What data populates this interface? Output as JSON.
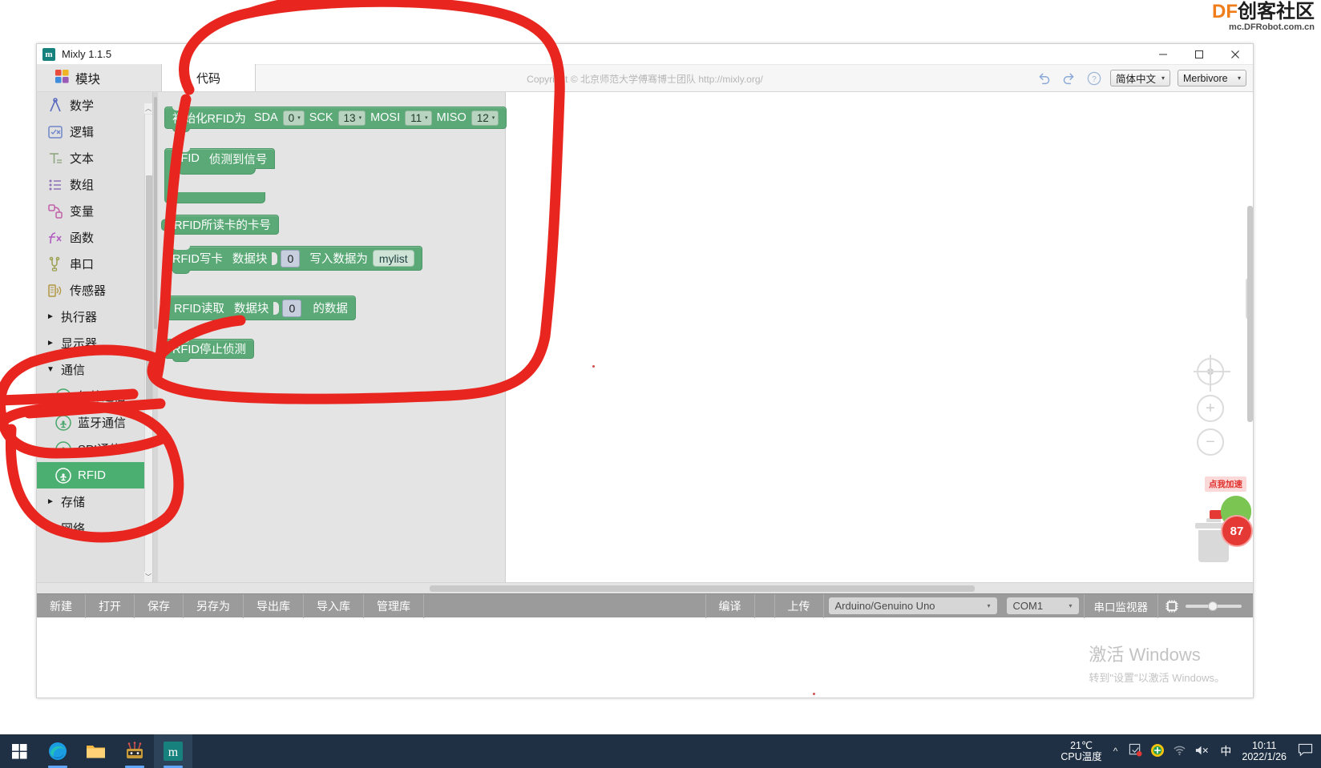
{
  "watermark": {
    "brand": "DF",
    "brand_cn": "创客社区",
    "url": "mc.DFRobot.com.cn"
  },
  "window": {
    "title": "Mixly 1.1.5",
    "app_icon": "m",
    "minimize": "—",
    "maximize": "☐",
    "close": "✕"
  },
  "topstrip": {
    "modules_label": "模块",
    "modules_icon": "blocks-icon",
    "tabs": [
      {
        "label": "代码"
      }
    ],
    "copyright": "Copyright © 北京师范大学傅骞博士团队 http://mixly.org/",
    "undo_icon": "undo-icon",
    "redo_icon": "redo-icon",
    "help_icon": "help-icon",
    "language": "简体中文",
    "theme": "Merbivore",
    "caret": "▾"
  },
  "sidebar": {
    "items": [
      {
        "label": "数学",
        "icon": "math-icon",
        "type": "leaf",
        "selected": false
      },
      {
        "label": "逻辑",
        "icon": "logic-icon",
        "type": "leaf",
        "selected": false
      },
      {
        "label": "文本",
        "icon": "text-icon",
        "type": "leaf",
        "selected": false
      },
      {
        "label": "数组",
        "icon": "array-icon",
        "type": "leaf",
        "selected": false
      },
      {
        "label": "变量",
        "icon": "variable-icon",
        "type": "leaf",
        "selected": false
      },
      {
        "label": "函数",
        "icon": "function-icon",
        "type": "leaf",
        "selected": false
      },
      {
        "label": "串口",
        "icon": "serial-icon",
        "type": "leaf",
        "selected": false
      },
      {
        "label": "传感器",
        "icon": "sensor-icon",
        "type": "leaf",
        "selected": false
      },
      {
        "label": "执行器",
        "icon": "",
        "type": "collapsed",
        "selected": false
      },
      {
        "label": "显示器",
        "icon": "",
        "type": "collapsed",
        "selected": false
      },
      {
        "label": "通信",
        "icon": "",
        "type": "expanded",
        "selected": false
      },
      {
        "label": "红外通信",
        "icon": "wireless-icon",
        "type": "child",
        "selected": false
      },
      {
        "label": "蓝牙通信",
        "icon": "wireless-icon",
        "type": "child",
        "selected": false
      },
      {
        "label": "SPI通信",
        "icon": "wireless-icon",
        "type": "child",
        "selected": false
      },
      {
        "label": "RFID",
        "icon": "wireless-icon",
        "type": "child",
        "selected": true
      },
      {
        "label": "存储",
        "icon": "",
        "type": "collapsed",
        "selected": false
      },
      {
        "label": "网络",
        "icon": "",
        "type": "collapsed",
        "selected": false
      }
    ],
    "arrow_collapsed": "►",
    "arrow_expanded": "▼"
  },
  "flyout_blocks": {
    "init": {
      "label": "初始化RFID为",
      "fields": [
        {
          "name": "SDA",
          "value": "0"
        },
        {
          "name": "SCK",
          "value": "13"
        },
        {
          "name": "MOSI",
          "value": "11"
        },
        {
          "name": "MISO",
          "value": "12"
        }
      ]
    },
    "detect": {
      "label_a": "RFID",
      "label_b": "侦测到信号"
    },
    "card_id": {
      "label": "RFID所读卡的卡号"
    },
    "write": {
      "label_a": "RFID写卡",
      "label_b": "数据块",
      "value": "0",
      "label_c": "写入数据为",
      "list": "mylist"
    },
    "read": {
      "label_a": "RFID读取",
      "label_b": "数据块",
      "value": "0",
      "label_c": "的数据"
    },
    "stop": {
      "label": "RFID停止侦测"
    }
  },
  "workspace_controls": {
    "center_icon": "center-target-icon",
    "zoom_in": "+",
    "zoom_out": "−",
    "trash_icon": "trash-icon"
  },
  "mascot": {
    "bubble": "点我加速",
    "score": "87"
  },
  "toolbar": {
    "buttons": [
      "新建",
      "打开",
      "保存",
      "另存为",
      "导出库",
      "导入库",
      "管理库"
    ],
    "compile": "编译",
    "upload": "上传",
    "board": "Arduino/Genuino Uno",
    "port": "COM1",
    "serial_monitor": "串口监视器",
    "chip_icon": "chip-icon",
    "caret": "▾"
  },
  "activate": {
    "line1": "激活 Windows",
    "line2": "转到\"设置\"以激活 Windows。"
  },
  "taskbar": {
    "icons": [
      {
        "name": "windows-start-icon",
        "active": false,
        "running": false
      },
      {
        "name": "edge-browser-icon",
        "active": false,
        "running": true
      },
      {
        "name": "file-explorer-icon",
        "active": false,
        "running": false
      },
      {
        "name": "robot-app-icon",
        "active": false,
        "running": true
      },
      {
        "name": "mixly-app-icon",
        "active": true,
        "running": true
      }
    ],
    "cpu_temp": "21℃",
    "cpu_label": "CPU温度",
    "ime": "中",
    "time": "10:11",
    "date": "2022/1/26",
    "overflow_icon": "^",
    "notification_icon": "notification-icon"
  },
  "annotation": {
    "color": "#e8261f",
    "stroke": 13
  }
}
